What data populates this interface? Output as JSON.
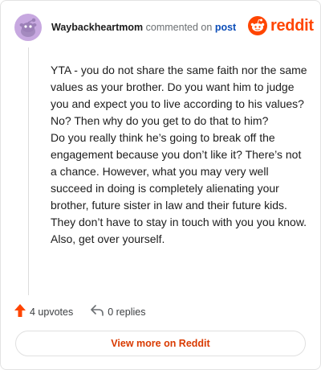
{
  "header": {
    "username": "Waybackheartmom",
    "commented_text": "commented on",
    "post_link": "post",
    "brand": "reddit",
    "avatar_icon": "snoo-avatar-icon",
    "brand_icon": "reddit-logo-icon"
  },
  "comment": {
    "paragraphs": [
      "YTA - you do not share the same faith nor the same values as your brother. Do you want him to judge you and expect you to live according to his values? No? Then why do you get to do that to him?",
      "Do you really think he’s going to break off the engagement because you don’t like it? There’s not a chance. However, what you may very well succeed in doing is completely alienating your brother, future sister in law and their future kids. They don’t have to stay in touch with you you know.",
      "Also, get over yourself."
    ]
  },
  "actions": {
    "upvotes": "4 upvotes",
    "replies": "0 replies",
    "upvote_icon": "upvote-arrow-icon",
    "reply_icon": "reply-arrow-icon"
  },
  "footer": {
    "view_more": "View more on Reddit"
  },
  "colors": {
    "brand": "#ff4500",
    "view_more": "#d93a00",
    "link": "#0b4db8",
    "avatar": "#c7a8e0"
  }
}
